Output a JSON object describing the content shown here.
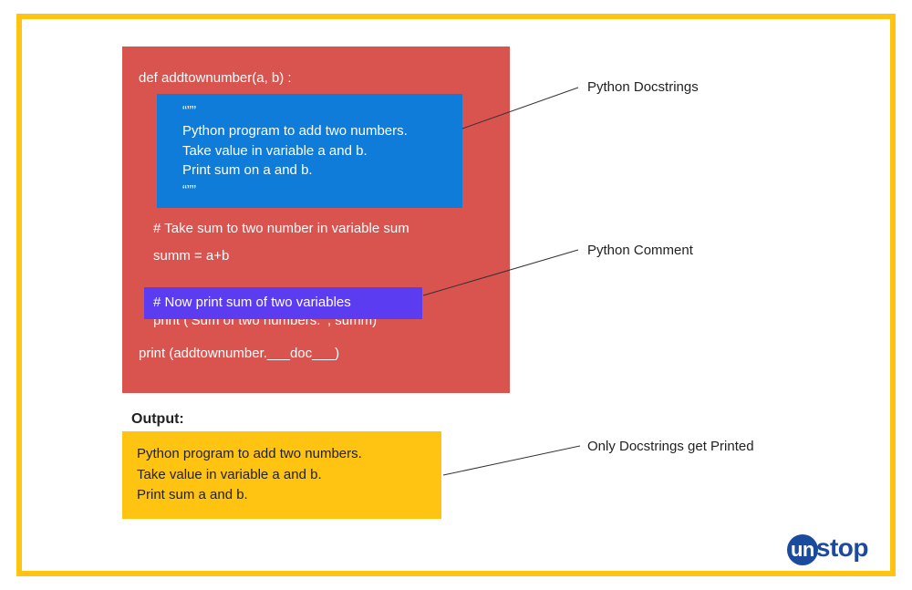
{
  "code": {
    "def_line": "def addtownumber(a, b) :",
    "docstring_open": "“””",
    "docstring_l1": "Python program to add two numbers.",
    "docstring_l2": "Take value in variable a and b.",
    "docstring_l3": "Print sum on a and b.",
    "docstring_close": "“””",
    "comment1": "# Take sum to two number in variable sum",
    "summ_line": "summ = a+b",
    "comment2": "# Now print sum of two variables",
    "print1": "print (‘Sum of two numbers: ’, summ)",
    "print2": "print (addtownumber.___doc___)"
  },
  "output": {
    "label": "Output:",
    "l1": "Python program to add two numbers.",
    "l2": "Take value in variable a and b.",
    "l3": "Print sum a and b."
  },
  "annotations": {
    "docstrings": "Python Docstrings",
    "comment": "Python Comment",
    "output_note": "Only Docstrings get Printed"
  },
  "logo": {
    "prefix": "un",
    "suffix": "stop"
  }
}
